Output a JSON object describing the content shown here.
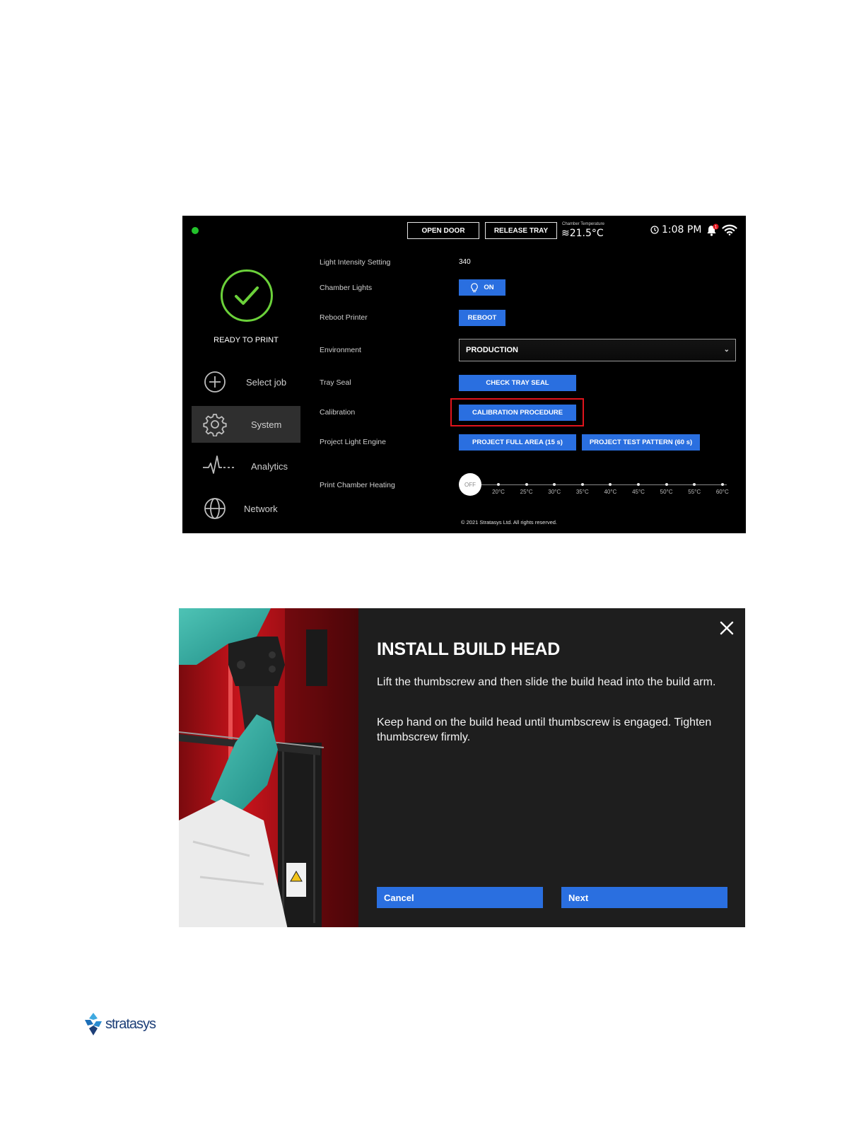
{
  "screen1": {
    "top_bar": {
      "open_door_label": "OPEN DOOR",
      "release_tray_label": "RELEASE TRAY",
      "chamber_temp_label": "Chamber Temperature",
      "chamber_temp_value": "≋21.5°C",
      "time": "1:08 PM",
      "notification_count": "1",
      "status_color": "#23c22b"
    },
    "status": {
      "text": "READY TO PRINT",
      "color": "#6bd13a"
    },
    "nav": [
      {
        "label": "Select job",
        "icon": "plus-circle-icon"
      },
      {
        "label": "System",
        "icon": "gear-icon",
        "active": true
      },
      {
        "label": "Analytics",
        "icon": "pulse-icon"
      },
      {
        "label": "Network",
        "icon": "globe-icon"
      }
    ],
    "settings": {
      "light_intensity": {
        "label": "Light Intensity Setting",
        "value": "340"
      },
      "chamber_lights": {
        "label": "Chamber Lights",
        "button": "ON"
      },
      "reboot": {
        "label": "Reboot Printer",
        "button": "REBOOT"
      },
      "environment": {
        "label": "Environment",
        "value": "PRODUCTION"
      },
      "tray_seal": {
        "label": "Tray Seal",
        "button": "CHECK TRAY SEAL"
      },
      "calibration": {
        "label": "Calibration",
        "button": "CALIBRATION PROCEDURE",
        "highlighted": true
      },
      "light_engine": {
        "label": "Project Light Engine",
        "button_full": "PROJECT FULL AREA (15 s)",
        "button_pattern": "PROJECT TEST PATTERN (60 s)"
      },
      "heating": {
        "label": "Print Chamber Heating",
        "state": "OFF",
        "ticks": [
          "20°C",
          "25°C",
          "30°C",
          "35°C",
          "40°C",
          "45°C",
          "50°C",
          "55°C",
          "60°C"
        ]
      }
    },
    "copyright": "© 2021 Stratasys Ltd. All rights reserved.",
    "accent_color": "#2a6fe0",
    "highlight_color": "#e0141c"
  },
  "screen2": {
    "title": "INSTALL BUILD HEAD",
    "paragraph1": "Lift the thumbscrew and then slide the build head into the build arm.",
    "paragraph2": "Keep hand on the build head until thumbscrew is engaged. Tighten thumbscrew firmly.",
    "cancel_label": "Cancel",
    "next_label": "Next"
  },
  "logo": {
    "text": "stratasys"
  }
}
